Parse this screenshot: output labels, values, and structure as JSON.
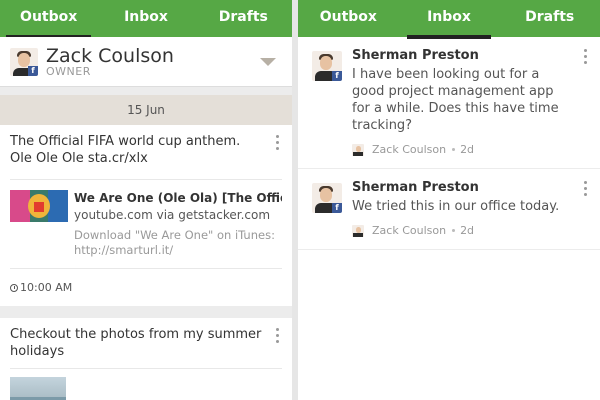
{
  "left_screen": {
    "tabs": [
      {
        "label": "Outbox",
        "active": true
      },
      {
        "label": "Inbox",
        "active": false
      },
      {
        "label": "Drafts",
        "active": false
      }
    ],
    "user": {
      "name": "Zack Coulson",
      "role": "OWNER",
      "avatar_icon": "profile-photo-with-facebook-badge"
    },
    "date_label": "15 Jun",
    "posts": [
      {
        "text": "The Official FIFA world cup anthem. Ole Ole Ole sta.cr/xlx",
        "link": {
          "title": "We Are One (Ole Ola) [The Official",
          "source": "youtube.com via getstacker.com",
          "description": "Download \"We Are One\" on iTunes: http://smarturl.it/"
        },
        "time": "10:00 AM"
      },
      {
        "text": "Checkout the photos from my summer holidays"
      }
    ]
  },
  "right_screen": {
    "tabs": [
      {
        "label": "Outbox",
        "active": false
      },
      {
        "label": "Inbox",
        "active": true
      },
      {
        "label": "Drafts",
        "active": false
      }
    ],
    "messages": [
      {
        "sender": "Sherman Preston",
        "text": "I have been looking out for a good project management app for a while. Does this have time tracking?",
        "assignee": "Zack Coulson",
        "age": "2d"
      },
      {
        "sender": "Sherman Preston",
        "text": "We tried this in our office today.",
        "assignee": "Zack Coulson",
        "age": "2d"
      }
    ]
  },
  "colors": {
    "tab_bar": "#56a845",
    "date_bar": "#e4dfd8",
    "facebook": "#3b5998"
  }
}
